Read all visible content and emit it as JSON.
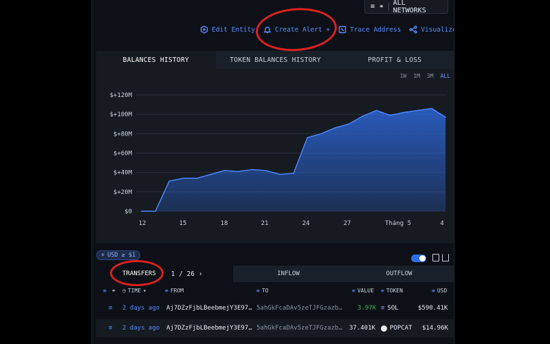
{
  "network": {
    "label": "ALL NETWORKS"
  },
  "actions": {
    "edit_entity": "Edit Entity",
    "create_alert": "Create Alert +",
    "trace_address": "Trace Address",
    "visualize": "Visualize"
  },
  "chart_tabs": [
    "BALANCES HISTORY",
    "TOKEN BALANCES HISTORY",
    "PROFIT & LOSS"
  ],
  "ranges": [
    "1W",
    "1M",
    "3M",
    "ALL"
  ],
  "chart_data": {
    "type": "area",
    "title": "",
    "xlabel": "",
    "ylabel": "",
    "ylim": [
      0,
      120
    ],
    "y_ticks": [
      "$0",
      "$+20M",
      "$+40M",
      "$+60M",
      "$+80M",
      "$+100M",
      "$+120M"
    ],
    "x_ticks": [
      "12",
      "15",
      "18",
      "21",
      "24",
      "27",
      "Tháng 5",
      "4"
    ],
    "series": [
      {
        "values": [
          0,
          0,
          31,
          34,
          34,
          38,
          42,
          41,
          43,
          42,
          38,
          39,
          76,
          80,
          86,
          90,
          98,
          104,
          99,
          102,
          104,
          106,
          97
        ]
      }
    ],
    "color": "#2f6fed"
  },
  "filters": {
    "usd_chip": "USD ≥ $1"
  },
  "table_tabs": {
    "transfers": "TRANSFERS",
    "pager": "1 / 26",
    "inflow": "INFLOW",
    "outflow": "OUTFLOW"
  },
  "table": {
    "headers": {
      "time": "TIME",
      "from": "FROM",
      "to": "TO",
      "value": "VALUE",
      "token": "TOKEN",
      "usd": "USD"
    },
    "rows": [
      {
        "time": "2 days ago",
        "from": "Aj7DZzFjbLBeebmejY3E97…",
        "to": "5ahGkFcaDAv5zeTJFGzazb…",
        "value": "3.97K",
        "token": "SOL",
        "usd": "$590.41K"
      },
      {
        "time": "2 days ago",
        "from": "Aj7DZzFjbLBeebmejY3E97…",
        "to": "5ahGkFcaDAv5zeTJFGzazb…",
        "value": "37.401K",
        "token": "POPCAT",
        "usd": "$14.96K"
      }
    ]
  }
}
